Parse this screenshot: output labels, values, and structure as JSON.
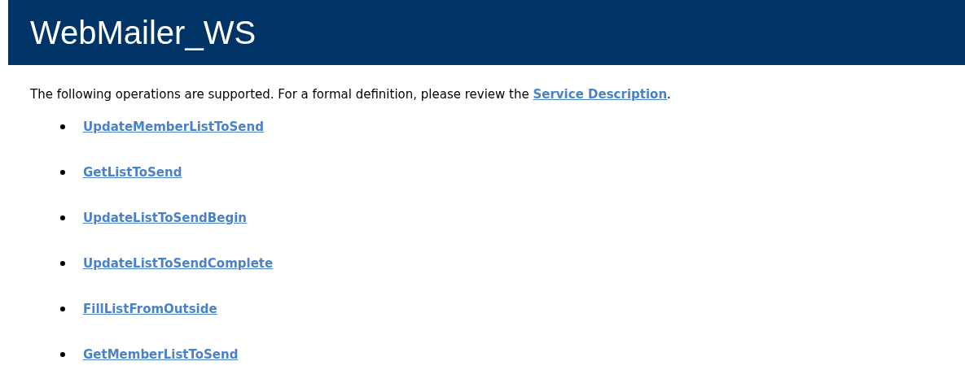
{
  "header": {
    "title": "WebMailer_WS"
  },
  "intro": {
    "text": "The following operations are supported. For a formal definition, please review the ",
    "link": "Service Description",
    "after": "."
  },
  "operations": [
    {
      "label": "UpdateMemberListToSend"
    },
    {
      "label": "GetListToSend"
    },
    {
      "label": "UpdateListToSendBegin"
    },
    {
      "label": "UpdateListToSendComplete"
    },
    {
      "label": "FillListFromOutside"
    },
    {
      "label": "GetMemberListToSend"
    }
  ]
}
